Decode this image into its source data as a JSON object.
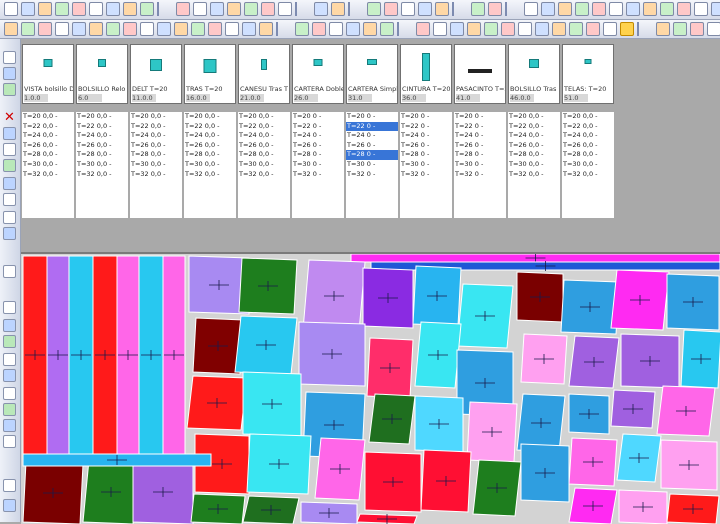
{
  "toolbar_icons": [
    "pointer-icon",
    "new-file-icon",
    "open-folder-icon",
    "save-icon",
    "save-as-icon",
    "print-icon",
    "print-preview-icon",
    "export-icon",
    "undo-icon",
    "redo-icon",
    "copy-icon",
    "paste-icon",
    "refresh-icon",
    "grid-icon",
    "settings-icon",
    "info-icon",
    "recycle-icon",
    "markers-icon",
    "measure-icon",
    "text-icon",
    "zoom-icon",
    "piece-icon",
    "rotate-icon",
    "layout-icon",
    "window-icon",
    "tile-icon",
    "network-icon",
    "help-icon"
  ],
  "pieces": [
    {
      "name": "VISTA bolsillo D",
      "qty": "1.0.0"
    },
    {
      "name": "BOLSILLO Relo",
      "qty": "6.0"
    },
    {
      "name": "DELT T=20",
      "qty": "11.0.0"
    },
    {
      "name": "TRAS T=20",
      "qty": "16.0.0"
    },
    {
      "name": "CANESU Tras T",
      "qty": "21.0.0"
    },
    {
      "name": "CARTERA Doble",
      "qty": "26.0"
    },
    {
      "name": "CARTERA Simpl",
      "qty": "31.0"
    },
    {
      "name": "CINTURA T=20",
      "qty": "36.0"
    },
    {
      "name": "PASACINTO T=2",
      "qty": "41.0"
    },
    {
      "name": "BOLSILLO Tras",
      "qty": "46.0.0"
    },
    {
      "name": "TELAS: T=20",
      "qty": "51.0"
    }
  ],
  "sizes": [
    [
      "T=20 0,0 -",
      "T=22 0,0 -",
      "T=24 0,0 -",
      "T=26 0,0 -",
      "T=28 0,0 -",
      "T=30 0,0 -",
      "T=32 0,0 -"
    ],
    [
      "T=20 0,0 -",
      "T=22 0,0 -",
      "T=24 0,0 -",
      "T=26 0,0 -",
      "T=28 0,0 -",
      "T=30 0,0 -",
      "T=32 0,0 -"
    ],
    [
      "T=20 0,0 -",
      "T=22 0,0 -",
      "T=24 0,0 -",
      "T=26 0,0 -",
      "T=28 0,0 -",
      "T=30 0,0 -",
      "T=32 0,0 -"
    ],
    [
      "T=20 0,0 -",
      "T=22 0,0 -",
      "T=24 0,0 -",
      "T=26 0,0 -",
      "T=28 0,0 -",
      "T=30 0,0 -",
      "T=32 0,0 -"
    ],
    [
      "T=20 0,0 -",
      "T=22 0,0 -",
      "T=24 0,0 -",
      "T=26 0,0 -",
      "T=28 0,0 -",
      "T=30 0,0 -",
      "T=32 0,0 -"
    ],
    [
      "T=20 0 -",
      "T=22 0 -",
      "T=24 0 -",
      "T=26 0 -",
      "T=28 0 -",
      "T=30 0 -",
      "T=32 0 -"
    ],
    [
      "T=20 0 -",
      "T=22 0 -",
      "T=24 0 -",
      "T=26 0 -",
      "T=28 0 -",
      "T=30 0 -",
      "T=32 0 -"
    ],
    [
      "T=20 0 -",
      "T=22 0 -",
      "T=24 0 -",
      "T=26 0 -",
      "T=28 0 -",
      "T=30 0 -",
      "T=32 0 -"
    ],
    [
      "T=20 0 -",
      "T=22 0 -",
      "T=24 0 -",
      "T=26 0 -",
      "T=28 0 -",
      "T=30 0 -",
      "T=32 0 -"
    ],
    [
      "T=20 0,0 -",
      "T=22 0,0 -",
      "T=24 0,0 -",
      "T=26 0,0 -",
      "T=28 0,0 -",
      "T=30 0,0 -",
      "T=32 0,0 -"
    ],
    [
      "T=20 0,0 -",
      "T=22 0,0 -",
      "T=24 0,0 -",
      "T=26 0,0 -",
      "T=28 0,0 -",
      "T=30 0,0 -",
      "T=32 0,0 -"
    ]
  ],
  "selected_sizes": {
    "column": 6,
    "rows": [
      1,
      4
    ]
  },
  "marker_colors": [
    "#ff1a1a",
    "#b06cf2",
    "#28c8f0",
    "#ff1a1a",
    "#ff66e8",
    "#28c8f0",
    "#ff66e8",
    "#a88af2",
    "#1e7e1e",
    "#c08af0",
    "#800000",
    "#28b4f0",
    "#8a2be2",
    "#ff0f33",
    "#39e6f2",
    "#2f9ee0",
    "#ffa0f0",
    "#1f6f1f",
    "#ff2d6a",
    "#a060e0",
    "#4fd8ff",
    "#7a0000",
    "#ff2af2"
  ]
}
